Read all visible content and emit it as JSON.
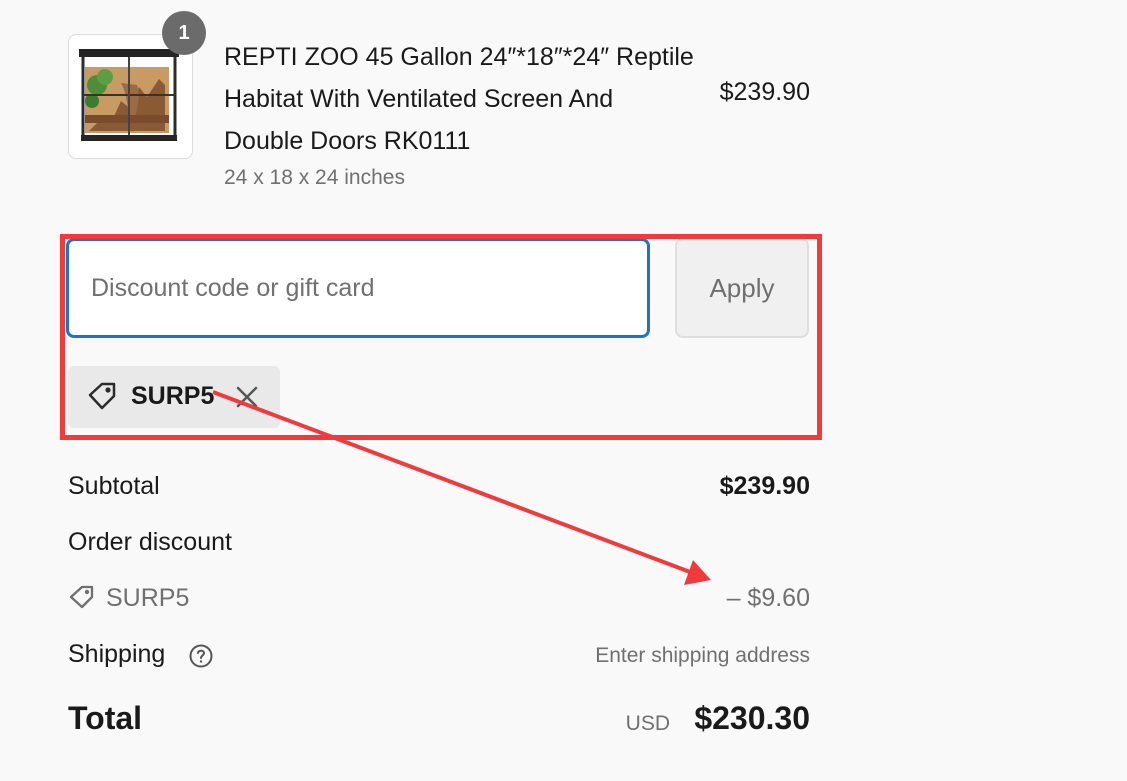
{
  "product": {
    "quantity": "1",
    "title": "REPTI ZOO 45 Gallon 24″*18″*24″ Reptile Habitat With Ventilated Screen And Double Doors RK0111",
    "variant": "24 x 18 x 24 inches",
    "price": "$239.90"
  },
  "discount": {
    "placeholder": "Discount code or gift card",
    "input_value": "",
    "apply_label": "Apply",
    "applied_code": "SURP5"
  },
  "summary": {
    "subtotal_label": "Subtotal",
    "subtotal_value": "$239.90",
    "order_discount_label": "Order discount",
    "discount_code": "SURP5",
    "discount_amount": "– $9.60",
    "shipping_label": "Shipping",
    "shipping_value": "Enter shipping address",
    "total_label": "Total",
    "currency": "USD",
    "total_value": "$230.30"
  },
  "colors": {
    "background": "#f9f9f9",
    "input_focus_border": "#1f74c2",
    "annotation_red": "#ef3b3b",
    "muted_text": "#707070"
  },
  "icons": [
    "product-thumbnail-image",
    "tag-icon",
    "close-icon",
    "help-circle-icon"
  ]
}
